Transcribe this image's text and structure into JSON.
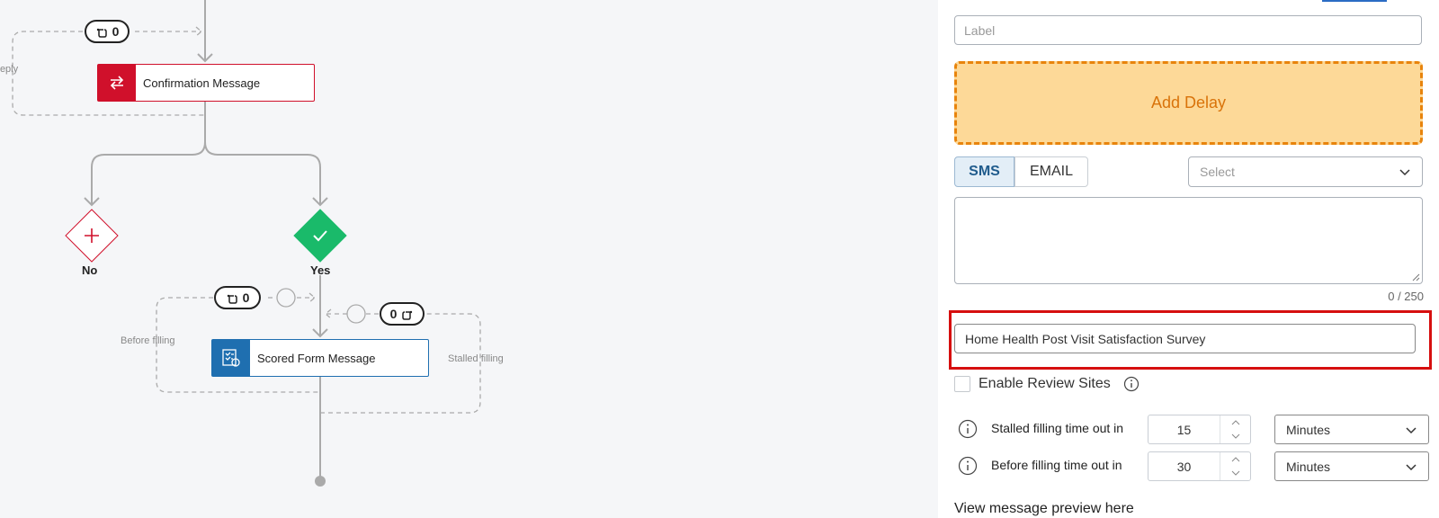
{
  "flow": {
    "reply_label": "Reply",
    "top_pill_count": "0",
    "confirmation_node_label": "Confirmation Message",
    "no_label": "No",
    "yes_label": "Yes",
    "before_pill_count": "0",
    "stalled_pill_count": "0",
    "scored_node_label": "Scored Form Message",
    "before_filling_label": "Before filling",
    "stalled_filling_label": "Stalled filling"
  },
  "panel": {
    "label_placeholder": "Label",
    "add_delay_label": "Add Delay",
    "tabs": {
      "sms": "SMS",
      "email": "EMAIL"
    },
    "select_placeholder": "Select",
    "message_value": "",
    "char_count": "0 / 250",
    "survey_value": "Home Health Post Visit Satisfaction Survey",
    "enable_review_sites": "Enable Review Sites",
    "stalled_row": {
      "label": "Stalled filling time out in",
      "value": "15",
      "unit": "Minutes"
    },
    "before_row": {
      "label": "Before filling time out in",
      "value": "30",
      "unit": "Minutes"
    },
    "preview_link": "View message preview here"
  },
  "colors": {
    "brand_red": "#d0102b",
    "brand_blue": "#1f6fb0",
    "success_green": "#1aba6a",
    "delay_orange": "#e8840c",
    "highlight_red": "#d60f0f"
  }
}
